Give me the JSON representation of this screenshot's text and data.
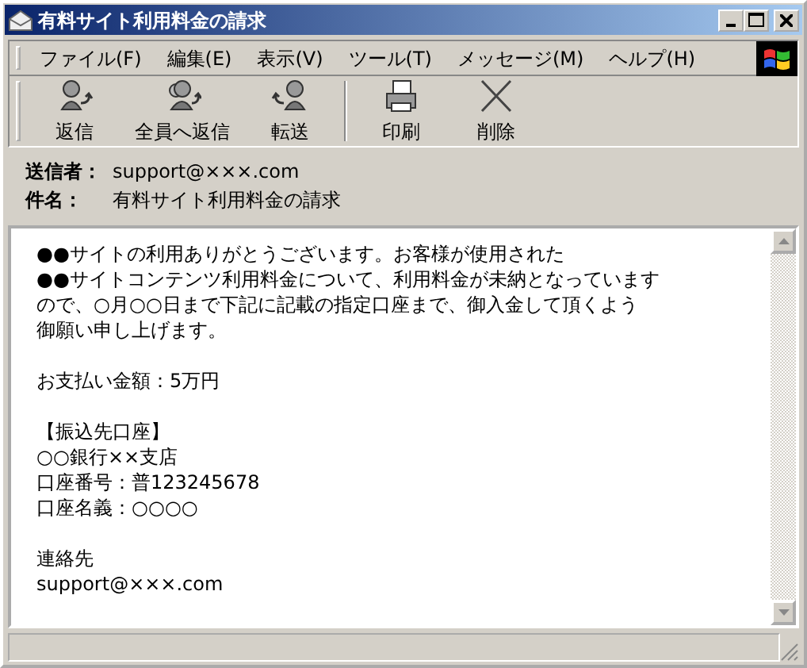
{
  "window": {
    "title": "有料サイト利用料金の請求"
  },
  "menu": [
    "ファイル(F)",
    "編集(E)",
    "表示(V)",
    "ツール(T)",
    "メッセージ(M)",
    "ヘルプ(H)"
  ],
  "toolbar": [
    [
      {
        "label": "返信",
        "kind": "reply"
      },
      {
        "label": "全員へ返信",
        "kind": "reply-all"
      },
      {
        "label": "転送",
        "kind": "forward"
      }
    ],
    [
      {
        "label": "印刷",
        "kind": "print"
      },
      {
        "label": "削除",
        "kind": "delete"
      }
    ]
  ],
  "header": [
    {
      "label": "送信者：",
      "value": "support@×××.com"
    },
    {
      "label": "件名：",
      "value": "有料サイト利用料金の請求"
    }
  ],
  "body": {
    "paragraphs": [
      [
        "●●サイトの利用ありがとうございます。お客様が使用された",
        "●●サイトコンテンツ利用料金について、利用料金が未納となっています",
        "ので、○月○○日まで下記に記載の指定口座まで、御入金して頂くよう",
        "御願い申し上げます。"
      ],
      [
        "お支払い金額：5万円"
      ],
      [
        "【振込先口座】",
        "○○銀行××支店",
        "口座番号：普123245678",
        "口座名義：○○○○"
      ],
      [
        "連絡先",
        "support@×××.com"
      ]
    ]
  }
}
